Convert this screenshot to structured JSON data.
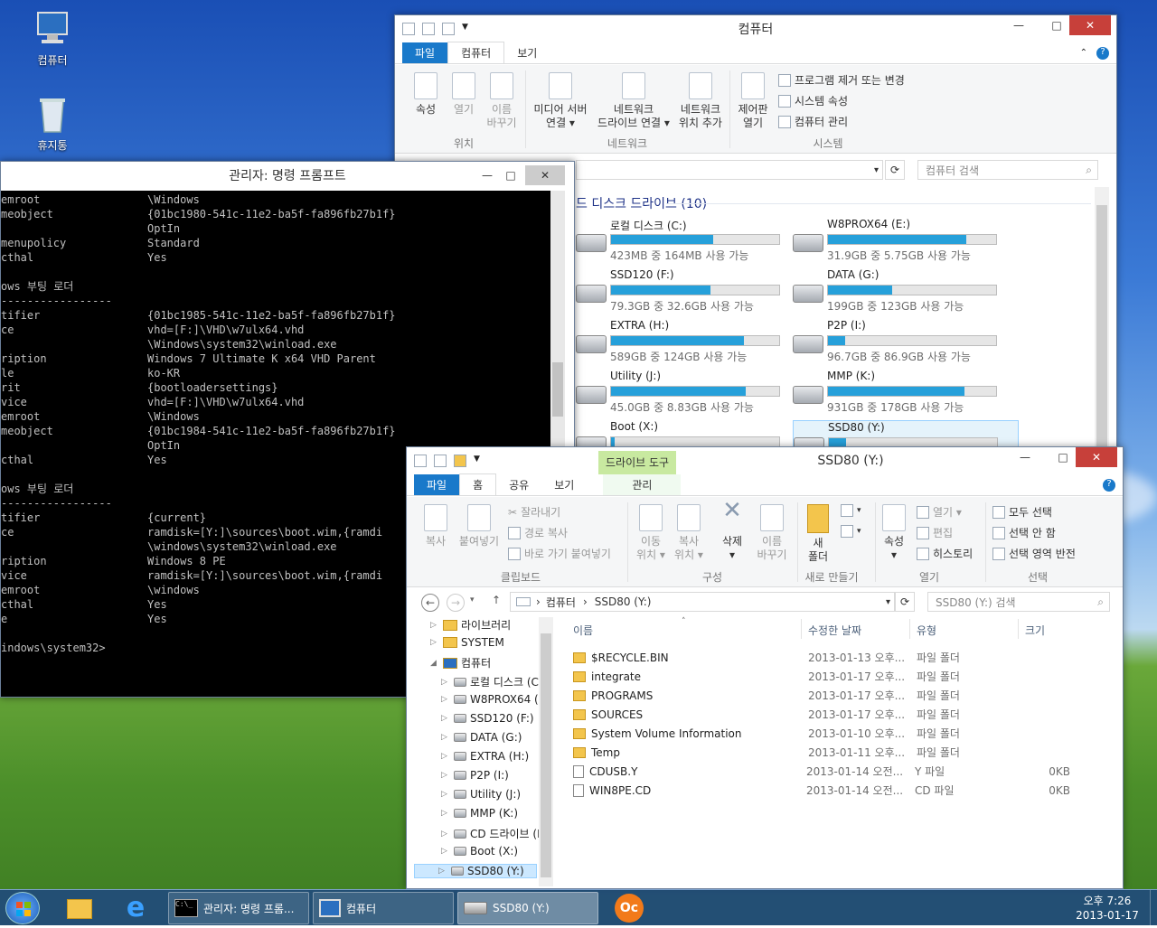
{
  "desktop": {
    "icons": [
      {
        "label": "컴퓨터"
      },
      {
        "label": "휴지통"
      }
    ]
  },
  "computer_window": {
    "title": "컴퓨터",
    "tabs": [
      "파일",
      "컴퓨터",
      "보기"
    ],
    "ribbon": {
      "location": {
        "label": "위치",
        "buttons": [
          "속성",
          "열기",
          "이름\n바꾸기"
        ]
      },
      "network": {
        "label": "네트워크",
        "buttons": [
          "미디어 서버\n연결 ▾",
          "네트워크\n드라이브 연결 ▾",
          "네트워크\n위치 추가"
        ]
      },
      "system": {
        "label": "시스템",
        "control_panel": "제어판\n열기",
        "items": [
          "프로그램 제거 또는 변경",
          "시스템 속성",
          "컴퓨터 관리"
        ]
      }
    },
    "search_placeholder": "컴퓨터 검색",
    "section_header": "드 디스크 드라이브 (10)",
    "drives": [
      {
        "name": "로컬 디스크 (C:)",
        "free": "423MB 중 164MB 사용 가능",
        "used": 0.61
      },
      {
        "name": "W8PROX64 (E:)",
        "free": "31.9GB 중 5.75GB 사용 가능",
        "used": 0.82
      },
      {
        "name": "SSD120 (F:)",
        "free": "79.3GB 중 32.6GB 사용 가능",
        "used": 0.59
      },
      {
        "name": "DATA (G:)",
        "free": "199GB 중 123GB 사용 가능",
        "used": 0.38
      },
      {
        "name": "EXTRA (H:)",
        "free": "589GB 중 124GB 사용 가능",
        "used": 0.79
      },
      {
        "name": "P2P (I:)",
        "free": "96.7GB 중 86.9GB 사용 가능",
        "used": 0.1
      },
      {
        "name": "Utility (J:)",
        "free": "45.0GB 중 8.83GB 사용 가능",
        "used": 0.8
      },
      {
        "name": "MMP (K:)",
        "free": "931GB 중 178GB 사용 가능",
        "used": 0.81
      },
      {
        "name": "Boot (X:)",
        "free": "",
        "used": 0.02
      },
      {
        "name": "SSD80 (Y:)",
        "free": "",
        "used": 0.1
      }
    ]
  },
  "cmd_window": {
    "title": "관리자: 명령 프롬프트",
    "lines": [
      [
        "emroot",
        "\\Windows"
      ],
      [
        "meobject",
        "{01bc1980-541c-11e2-ba5f-fa896fb27b1f}"
      ],
      [
        "",
        "OptIn"
      ],
      [
        "menupolicy",
        "Standard"
      ],
      [
        "cthal",
        "Yes"
      ],
      [
        "",
        ""
      ],
      [
        "ows 부팅 로더",
        ""
      ],
      [
        "-----------------",
        ""
      ],
      [
        "tifier",
        "{01bc1985-541c-11e2-ba5f-fa896fb27b1f}"
      ],
      [
        "ce",
        "vhd=[F:]\\VHD\\w7ulx64.vhd"
      ],
      [
        "",
        "\\Windows\\system32\\winload.exe"
      ],
      [
        "ription",
        "Windows 7 Ultimate K x64 VHD Parent"
      ],
      [
        "le",
        "ko-KR"
      ],
      [
        "rit",
        "{bootloadersettings}"
      ],
      [
        "vice",
        "vhd=[F:]\\VHD\\w7ulx64.vhd"
      ],
      [
        "emroot",
        "\\Windows"
      ],
      [
        "meobject",
        "{01bc1984-541c-11e2-ba5f-fa896fb27b1f}"
      ],
      [
        "",
        "OptIn"
      ],
      [
        "cthal",
        "Yes"
      ],
      [
        "",
        ""
      ],
      [
        "ows 부팅 로더",
        ""
      ],
      [
        "-----------------",
        ""
      ],
      [
        "tifier",
        "{current}"
      ],
      [
        "ce",
        "ramdisk=[Y:]\\sources\\boot.wim,{ramdi"
      ],
      [
        "",
        "\\windows\\system32\\winload.exe"
      ],
      [
        "ription",
        "Windows 8 PE"
      ],
      [
        "vice",
        "ramdisk=[Y:]\\sources\\boot.wim,{ramdi"
      ],
      [
        "emroot",
        "\\windows"
      ],
      [
        "cthal",
        "Yes"
      ],
      [
        "e",
        "Yes"
      ],
      [
        "",
        ""
      ],
      [
        "indows\\system32>",
        ""
      ]
    ]
  },
  "ssd_window": {
    "title": "SSD80 (Y:)",
    "context_tab": "드라이브 도구",
    "tabs": [
      "파일",
      "홈",
      "공유",
      "보기",
      "관리"
    ],
    "ribbon": {
      "clipboard": {
        "label": "클립보드",
        "copy": "복사",
        "paste": "붙여넣기",
        "items": [
          "잘라내기",
          "경로 복사",
          "바로 가기 붙여넣기"
        ]
      },
      "organize": {
        "label": "구성",
        "buttons": [
          "이동\n위치 ▾",
          "복사\n위치 ▾",
          "삭제\n▾",
          "이름\n바꾸기"
        ]
      },
      "new": {
        "label": "새로 만들기",
        "button": "새\n폴더"
      },
      "open": {
        "label": "열기",
        "props": "속성\n▾",
        "items": [
          "열기 ▾",
          "편집",
          "히스토리"
        ]
      },
      "select": {
        "label": "선택",
        "items": [
          "모두 선택",
          "선택 안 함",
          "선택 영역 반전"
        ]
      }
    },
    "address": [
      "컴퓨터",
      "SSD80 (Y:)"
    ],
    "search_placeholder": "SSD80 (Y:) 검색",
    "tree": [
      {
        "label": "라이브러리",
        "indent": 0,
        "type": "folder"
      },
      {
        "label": "SYSTEM",
        "indent": 0,
        "type": "folder"
      },
      {
        "label": "컴퓨터",
        "indent": 0,
        "type": "pc"
      },
      {
        "label": "로컬 디스크 (C",
        "indent": 1,
        "type": "drive"
      },
      {
        "label": "W8PROX64 (E:",
        "indent": 1,
        "type": "drive"
      },
      {
        "label": "SSD120 (F:)",
        "indent": 1,
        "type": "drive"
      },
      {
        "label": "DATA (G:)",
        "indent": 1,
        "type": "drive"
      },
      {
        "label": "EXTRA (H:)",
        "indent": 1,
        "type": "drive"
      },
      {
        "label": "P2P (I:)",
        "indent": 1,
        "type": "drive"
      },
      {
        "label": "Utility (J:)",
        "indent": 1,
        "type": "drive"
      },
      {
        "label": "MMP (K:)",
        "indent": 1,
        "type": "drive"
      },
      {
        "label": "CD 드라이브 (I",
        "indent": 1,
        "type": "drive"
      },
      {
        "label": "Boot (X:)",
        "indent": 1,
        "type": "drive"
      },
      {
        "label": "SSD80 (Y:)",
        "indent": 1,
        "type": "drive",
        "selected": true
      }
    ],
    "columns": [
      "이름",
      "수정한 날짜",
      "유형",
      "크기"
    ],
    "files": [
      {
        "name": "$RECYCLE.BIN",
        "date": "2013-01-13 오후...",
        "type": "파일 폴더",
        "size": "",
        "kind": "folder"
      },
      {
        "name": "integrate",
        "date": "2013-01-17 오후...",
        "type": "파일 폴더",
        "size": "",
        "kind": "folder"
      },
      {
        "name": "PROGRAMS",
        "date": "2013-01-17 오후...",
        "type": "파일 폴더",
        "size": "",
        "kind": "folder"
      },
      {
        "name": "SOURCES",
        "date": "2013-01-17 오후...",
        "type": "파일 폴더",
        "size": "",
        "kind": "folder"
      },
      {
        "name": "System Volume Information",
        "date": "2013-01-10 오후...",
        "type": "파일 폴더",
        "size": "",
        "kind": "folder"
      },
      {
        "name": "Temp",
        "date": "2013-01-11 오후...",
        "type": "파일 폴더",
        "size": "",
        "kind": "folder"
      },
      {
        "name": "CDUSB.Y",
        "date": "2013-01-14 오전...",
        "type": "Y 파일",
        "size": "0KB",
        "kind": "file"
      },
      {
        "name": "WIN8PE.CD",
        "date": "2013-01-14 오전...",
        "type": "CD 파일",
        "size": "0KB",
        "kind": "file"
      }
    ]
  },
  "taskbar": {
    "buttons": [
      "관리자: 명령 프롬...",
      "컴퓨터",
      "SSD80 (Y:)"
    ],
    "clock_time": "오후 7:26",
    "clock_date": "2013-01-17"
  }
}
